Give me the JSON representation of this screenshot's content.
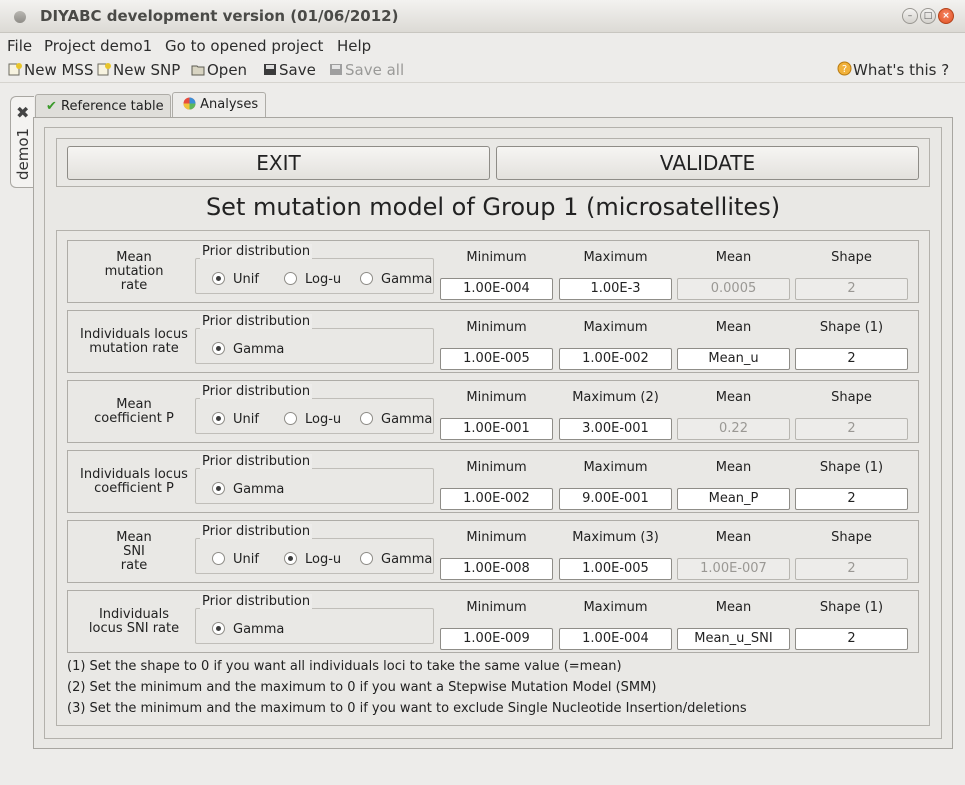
{
  "window": {
    "title": "DIYABC development version  (01/06/2012)"
  },
  "menu": [
    "File",
    "Project demo1",
    "Go to opened project",
    "Help"
  ],
  "toolbar": {
    "new_mss": "New MSS",
    "new_snp": "New SNP",
    "open": "Open",
    "save": "Save",
    "save_all": "Save all",
    "whats_this": "What's this ?"
  },
  "project_tab": "demo1",
  "tabs": [
    "Reference table",
    "Analyses"
  ],
  "buttons": {
    "exit": "EXIT",
    "validate": "VALIDATE"
  },
  "heading": "Set mutation model of Group 1 (microsatellites)",
  "prior_title": "Prior distribution",
  "rows": [
    {
      "label": "Mean\nmutation\nrate",
      "options": [
        "Unif",
        "Log-u",
        "Gamma"
      ],
      "selected": "Unif",
      "headers": [
        "Minimum",
        "Maximum",
        "Mean",
        "Shape"
      ],
      "values": [
        "1.00E-004",
        "1.00E-3",
        "0.0005",
        "2"
      ],
      "disabled": [
        false,
        false,
        true,
        true
      ]
    },
    {
      "label": "Individuals locus\nmutation rate",
      "options": [
        "Gamma"
      ],
      "selected": "Gamma",
      "headers": [
        "Minimum",
        "Maximum",
        "Mean",
        "Shape (1)"
      ],
      "values": [
        "1.00E-005",
        "1.00E-002",
        "Mean_u",
        "2"
      ],
      "disabled": [
        false,
        false,
        false,
        false
      ]
    },
    {
      "label": "Mean\ncoefficient P",
      "options": [
        "Unif",
        "Log-u",
        "Gamma"
      ],
      "selected": "Unif",
      "headers": [
        "Minimum",
        "Maximum (2)",
        "Mean",
        "Shape"
      ],
      "values": [
        "1.00E-001",
        "3.00E-001",
        "0.22",
        "2"
      ],
      "disabled": [
        false,
        false,
        true,
        true
      ]
    },
    {
      "label": "Individuals locus\ncoefficient P",
      "options": [
        "Gamma"
      ],
      "selected": "Gamma",
      "headers": [
        "Minimum",
        "Maximum",
        "Mean",
        "Shape (1)"
      ],
      "values": [
        "1.00E-002",
        "9.00E-001",
        "Mean_P",
        "2"
      ],
      "disabled": [
        false,
        false,
        false,
        false
      ]
    },
    {
      "label": "Mean\nSNI\nrate",
      "options": [
        "Unif",
        "Log-u",
        "Gamma"
      ],
      "selected": "Log-u",
      "headers": [
        "Minimum",
        "Maximum (3)",
        "Mean",
        "Shape"
      ],
      "values": [
        "1.00E-008",
        "1.00E-005",
        "1.00E-007",
        "2"
      ],
      "disabled": [
        false,
        false,
        true,
        true
      ]
    },
    {
      "label": "Individuals\nlocus SNI rate",
      "options": [
        "Gamma"
      ],
      "selected": "Gamma",
      "headers": [
        "Minimum",
        "Maximum",
        "Mean",
        "Shape (1)"
      ],
      "values": [
        "1.00E-009",
        "1.00E-004",
        "Mean_u_SNI",
        "2"
      ],
      "disabled": [
        false,
        false,
        false,
        false
      ]
    }
  ],
  "notes": [
    "(1) Set the shape to 0 if you want all individuals loci to take the same value (=mean)",
    "(2) Set the minimum and the maximum to 0 if you want a Stepwise Mutation Model (SMM)",
    "(3) Set the minimum and the maximum to 0 if you want to exclude Single Nucleotide Insertion/deletions"
  ],
  "colors": {
    "check_green": "#3a9a2a",
    "close_orange": "#e04f1d"
  }
}
